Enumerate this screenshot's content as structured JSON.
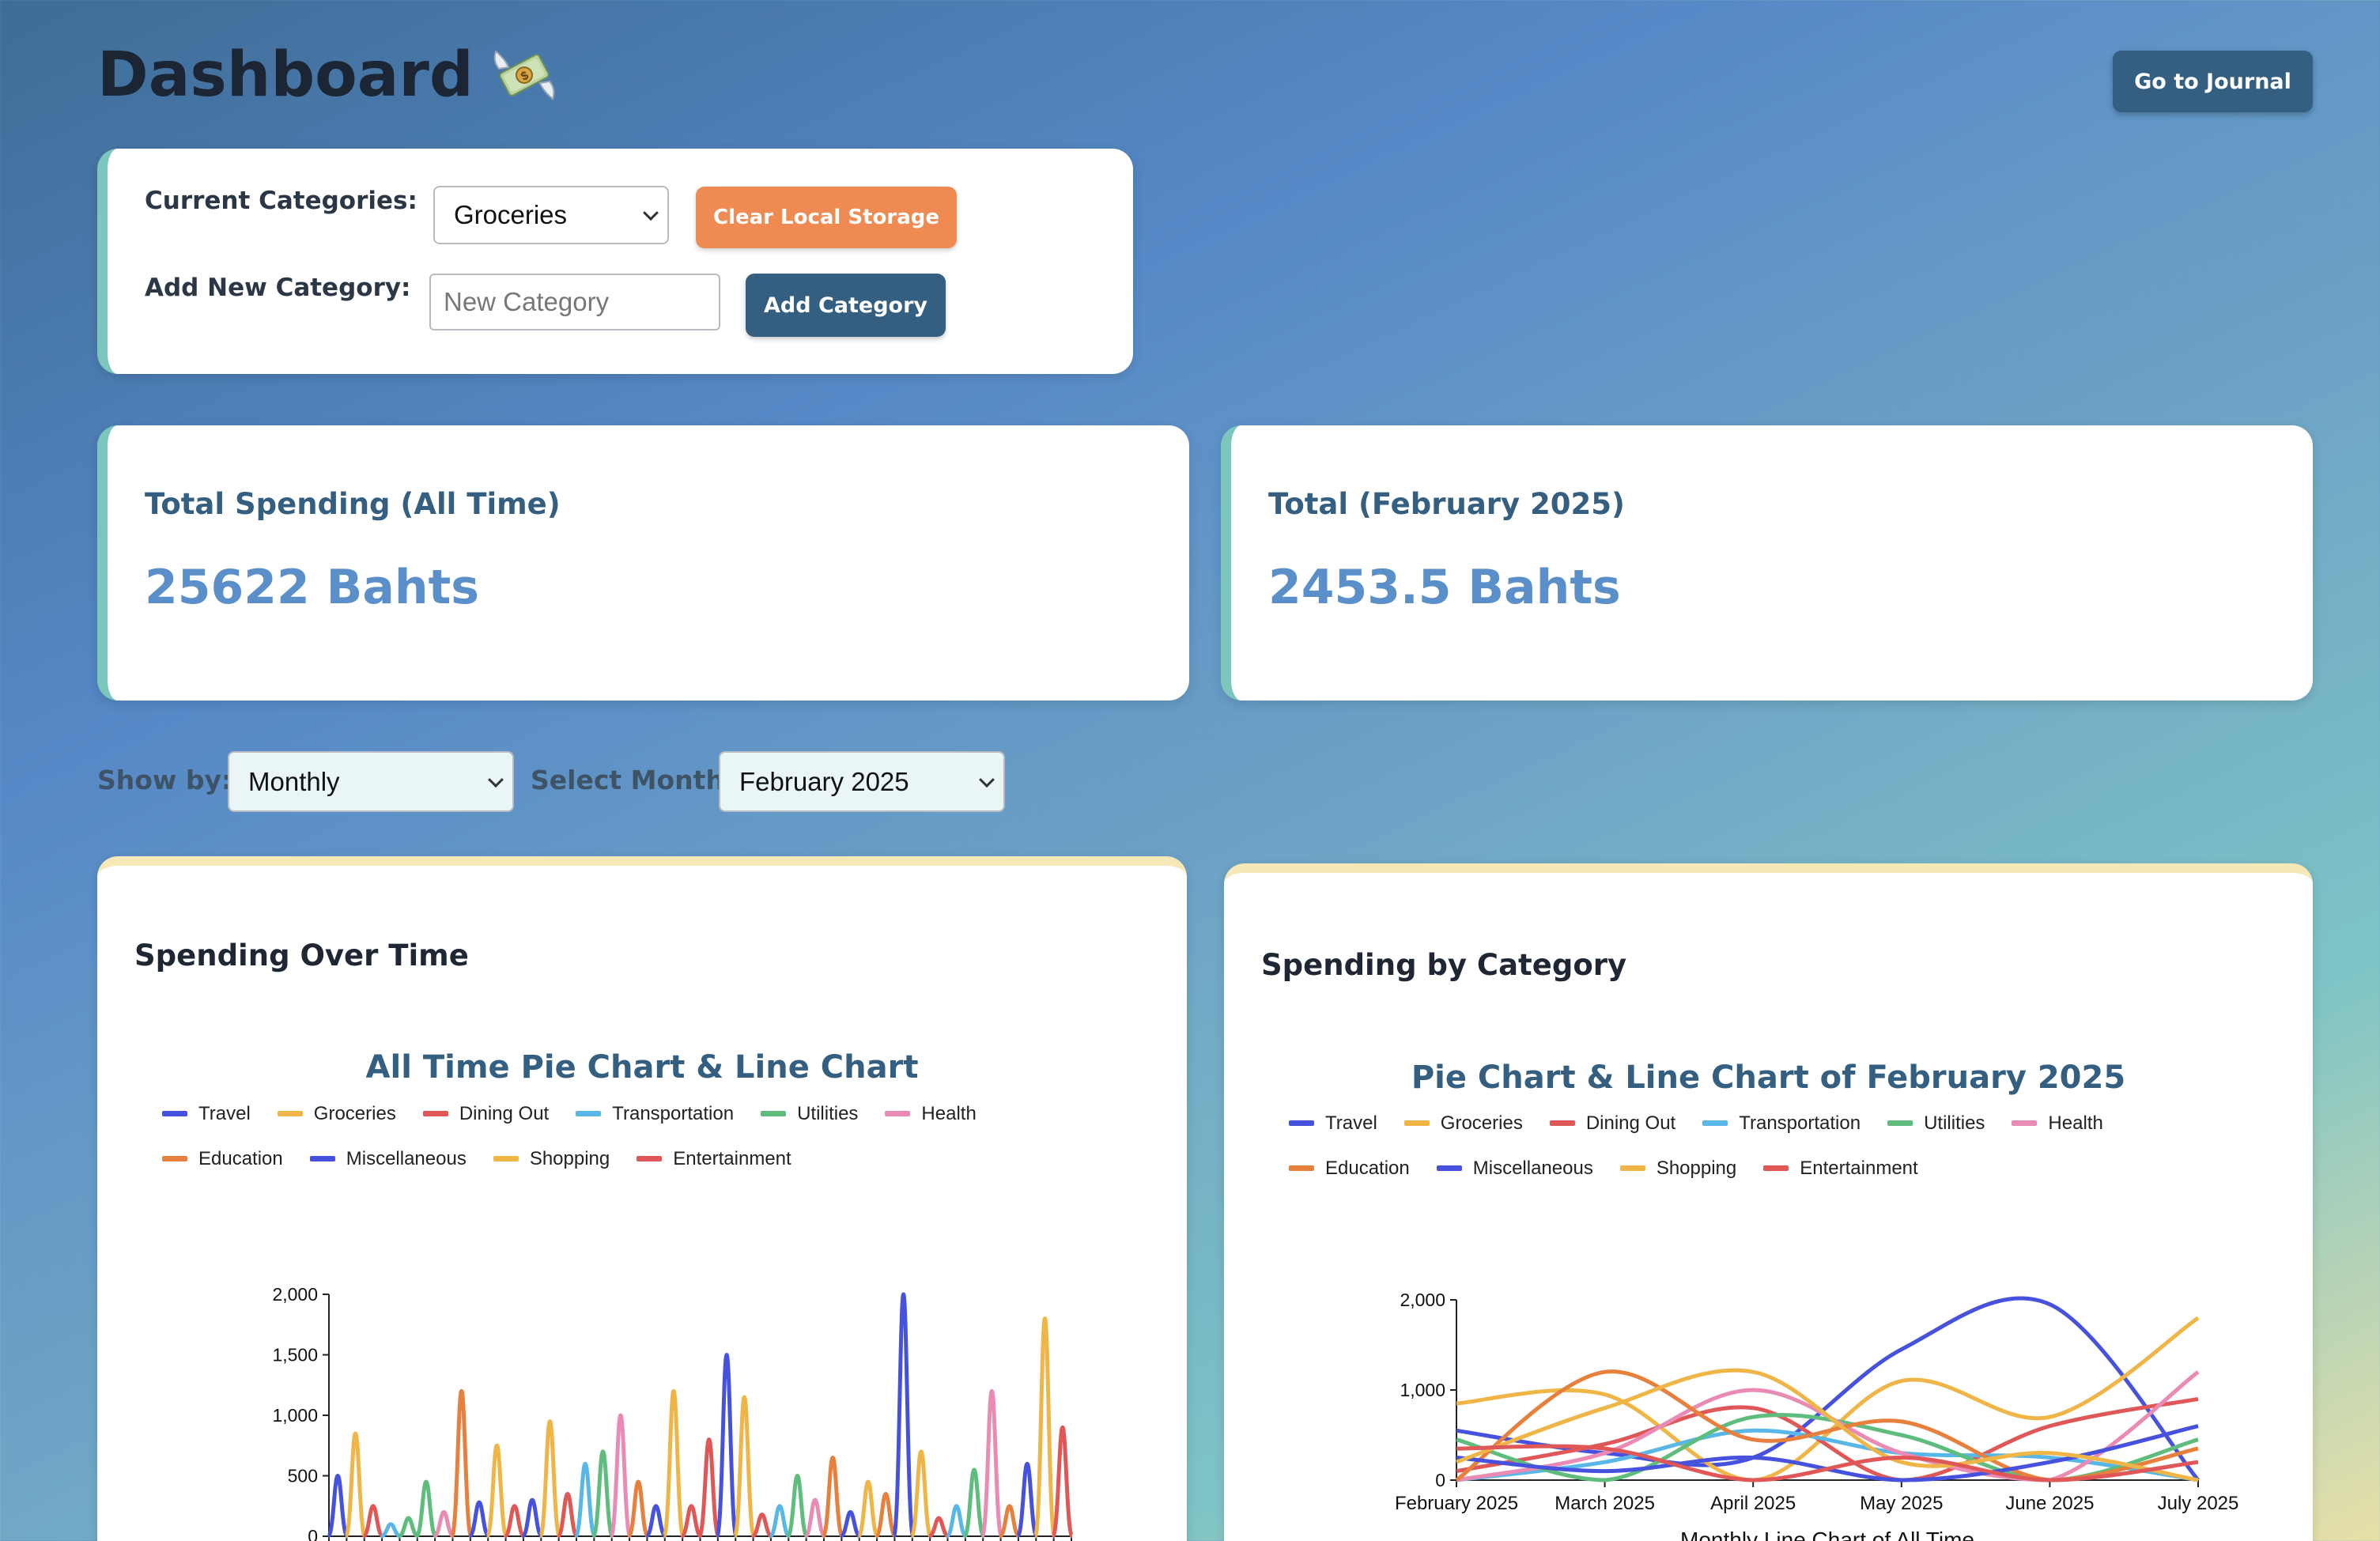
{
  "header": {
    "title": "Dashboard",
    "icon": "money-with-wings-icon",
    "journal_button": "Go to Journal"
  },
  "categories": {
    "current_label": "Current Categories:",
    "current_value": "Groceries",
    "clear_button": "Clear Local Storage",
    "add_label": "Add New Category:",
    "add_placeholder": "New Category",
    "add_button": "Add Category"
  },
  "stats": {
    "total_all_label": "Total Spending (All Time)",
    "total_all_value": "25622 Bahts",
    "total_month_label": "Total (February 2025)",
    "total_month_value": "2453.5 Bahts"
  },
  "filters": {
    "show_by_label": "Show by:",
    "show_by_value": "Monthly",
    "month_label": "Select Month:",
    "month_value": "February 2025"
  },
  "colors": {
    "Travel": "#4652dd",
    "Groceries": "#efb647",
    "Dining Out": "#e05757",
    "Transportation": "#58b7e6",
    "Utilities": "#5ebd7d",
    "Health": "#e98bb4",
    "Education": "#e6803c",
    "Miscellaneous": "#4652dd",
    "Shopping": "#efb647",
    "Entertainment": "#e05757"
  },
  "left_chart": {
    "card_title": "Spending Over Time",
    "subtitle": "All Time Pie Chart & Line Chart",
    "legend_rows": [
      [
        "Travel",
        "Groceries",
        "Dining Out",
        "Transportation",
        "Utilities",
        "Health"
      ],
      [
        "Education",
        "Miscellaneous",
        "Shopping",
        "Entertainment"
      ]
    ]
  },
  "right_chart": {
    "card_title": "Spending by Category",
    "subtitle": "Pie Chart & Line Chart of February 2025",
    "legend_rows": [
      [
        "Travel",
        "Groceries",
        "Dining Out",
        "Transportation",
        "Utilities",
        "Health"
      ],
      [
        "Education",
        "Miscellaneous",
        "Shopping",
        "Entertainment"
      ]
    ]
  },
  "chart_data": [
    {
      "type": "line",
      "title": "",
      "xlabel": "",
      "ylabel": "",
      "ylim": [
        0,
        2000
      ],
      "yticks": [
        "0",
        "500",
        "1,000",
        "1,500",
        "2,000"
      ],
      "points": [
        {
          "i": 0,
          "v": 500,
          "s": "Travel"
        },
        {
          "i": 1,
          "v": 850,
          "s": "Groceries"
        },
        {
          "i": 2,
          "v": 250,
          "s": "Dining Out"
        },
        {
          "i": 3,
          "v": 100,
          "s": "Transportation"
        },
        {
          "i": 4,
          "v": 150,
          "s": "Utilities"
        },
        {
          "i": 5,
          "v": 450,
          "s": "Utilities"
        },
        {
          "i": 6,
          "v": 200,
          "s": "Health"
        },
        {
          "i": 7,
          "v": 1200,
          "s": "Education"
        },
        {
          "i": 8,
          "v": 280,
          "s": "Travel"
        },
        {
          "i": 9,
          "v": 750,
          "s": "Groceries"
        },
        {
          "i": 10,
          "v": 250,
          "s": "Dining Out"
        },
        {
          "i": 11,
          "v": 300,
          "s": "Travel"
        },
        {
          "i": 12,
          "v": 950,
          "s": "Groceries"
        },
        {
          "i": 13,
          "v": 350,
          "s": "Dining Out"
        },
        {
          "i": 14,
          "v": 600,
          "s": "Transportation"
        },
        {
          "i": 15,
          "v": 700,
          "s": "Utilities"
        },
        {
          "i": 16,
          "v": 1000,
          "s": "Health"
        },
        {
          "i": 17,
          "v": 450,
          "s": "Education"
        },
        {
          "i": 18,
          "v": 250,
          "s": "Travel"
        },
        {
          "i": 19,
          "v": 1200,
          "s": "Groceries"
        },
        {
          "i": 20,
          "v": 250,
          "s": "Dining Out"
        },
        {
          "i": 21,
          "v": 800,
          "s": "Dining Out"
        },
        {
          "i": 22,
          "v": 1500,
          "s": "Travel"
        },
        {
          "i": 23,
          "v": 1150,
          "s": "Groceries"
        },
        {
          "i": 24,
          "v": 180,
          "s": "Dining Out"
        },
        {
          "i": 25,
          "v": 250,
          "s": "Transportation"
        },
        {
          "i": 26,
          "v": 500,
          "s": "Utilities"
        },
        {
          "i": 27,
          "v": 300,
          "s": "Health"
        },
        {
          "i": 28,
          "v": 650,
          "s": "Education"
        },
        {
          "i": 29,
          "v": 200,
          "s": "Travel"
        },
        {
          "i": 30,
          "v": 450,
          "s": "Groceries"
        },
        {
          "i": 31,
          "v": 350,
          "s": "Education"
        },
        {
          "i": 32,
          "v": 2000,
          "s": "Travel"
        },
        {
          "i": 33,
          "v": 700,
          "s": "Groceries"
        },
        {
          "i": 34,
          "v": 150,
          "s": "Dining Out"
        },
        {
          "i": 35,
          "v": 250,
          "s": "Transportation"
        },
        {
          "i": 36,
          "v": 550,
          "s": "Utilities"
        },
        {
          "i": 37,
          "v": 1200,
          "s": "Health"
        },
        {
          "i": 38,
          "v": 250,
          "s": "Education"
        },
        {
          "i": 39,
          "v": 600,
          "s": "Travel"
        },
        {
          "i": 40,
          "v": 1800,
          "s": "Groceries"
        },
        {
          "i": 41,
          "v": 900,
          "s": "Dining Out"
        }
      ]
    },
    {
      "type": "line",
      "title": "",
      "xlabel": "Monthly Line Chart of All Time",
      "ylabel": "",
      "ylim": [
        0,
        2000
      ],
      "yticks": [
        "0",
        "1,000",
        "2,000"
      ],
      "categories": [
        "February 2025",
        "March 2025",
        "April 2025",
        "May 2025",
        "June 2025",
        "July 2025"
      ],
      "series": [
        {
          "name": "Travel",
          "values": [
            550,
            300,
            250,
            1450,
            1950,
            0
          ]
        },
        {
          "name": "Groceries",
          "values": [
            850,
            950,
            0,
            1100,
            700,
            1800
          ]
        },
        {
          "name": "Dining Out",
          "values": [
            100,
            400,
            800,
            0,
            600,
            900
          ]
        },
        {
          "name": "Transportation",
          "values": [
            0,
            200,
            550,
            300,
            250,
            0
          ]
        },
        {
          "name": "Utilities",
          "values": [
            450,
            0,
            700,
            500,
            0,
            450
          ]
        },
        {
          "name": "Health",
          "values": [
            0,
            300,
            1000,
            300,
            0,
            1200
          ]
        },
        {
          "name": "Education",
          "values": [
            0,
            1200,
            450,
            650,
            0,
            350
          ]
        },
        {
          "name": "Miscellaneous",
          "values": [
            250,
            100,
            250,
            0,
            200,
            600
          ]
        },
        {
          "name": "Shopping",
          "values": [
            200,
            800,
            1200,
            200,
            300,
            0
          ]
        },
        {
          "name": "Entertainment",
          "values": [
            350,
            350,
            0,
            250,
            0,
            200
          ]
        }
      ]
    }
  ]
}
